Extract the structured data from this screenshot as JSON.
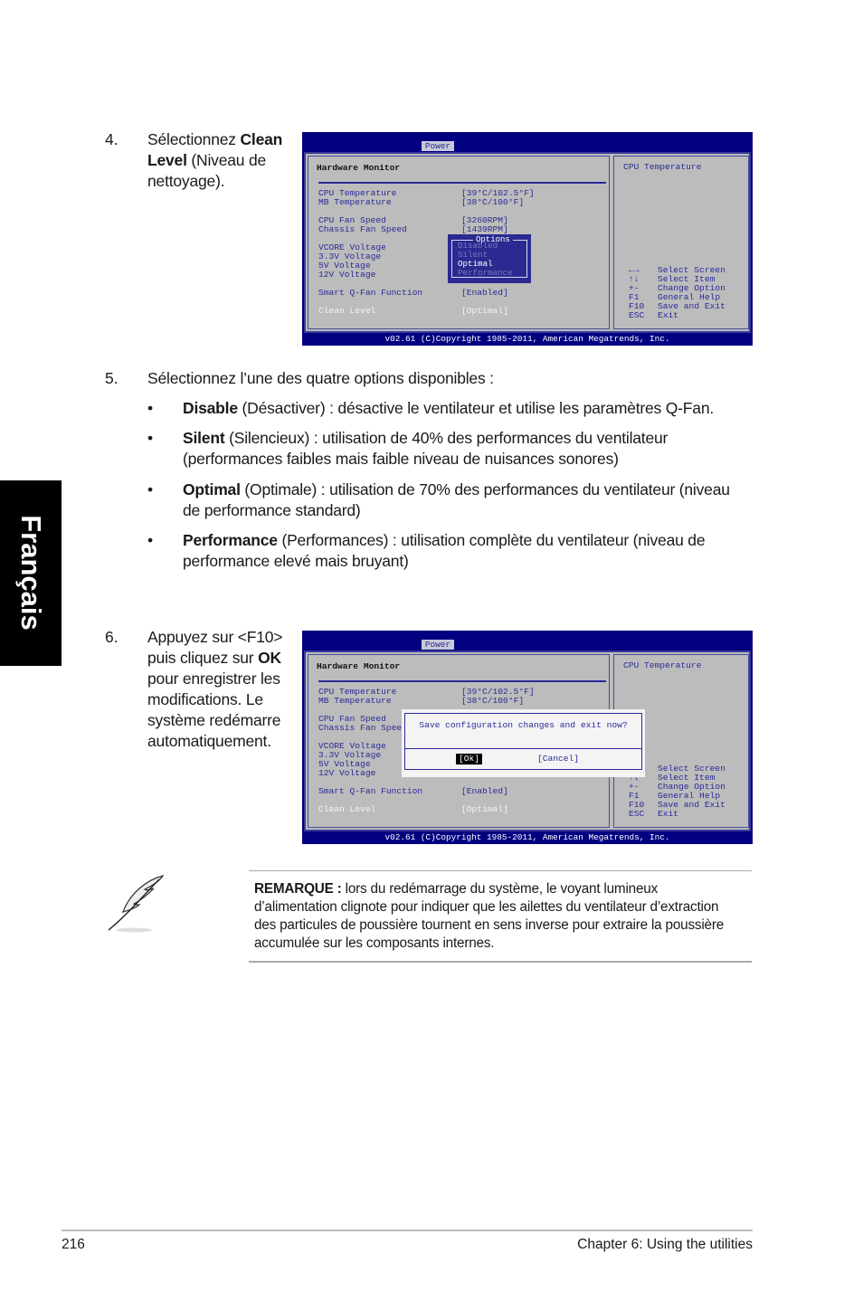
{
  "side_tab": "Français",
  "step4": {
    "number": "4.",
    "line1_pre": "Sélectionnez ",
    "line1_bold": "Clean",
    "line2_bold": "Level",
    "line2_rest": " (Niveau de",
    "line3": "nettoyage)."
  },
  "step5": {
    "number": "5.",
    "text": "Sélectionnez l’une des quatre options disponibles :",
    "bullets": [
      {
        "bold": "Disable",
        "lines": [
          " (Désactiver) : désactive le ventilateur et utilise les paramètres Q-Fan."
        ]
      },
      {
        "bold": "Silent",
        "lines": [
          " (Silencieux) : utilisation de 40% des performances du ventilateur",
          "(performances faibles mais faible niveau de nuisances sonores)"
        ]
      },
      {
        "bold": "Optimal",
        "lines": [
          " (Optimale) : utilisation de 70% des performances du ventilateur (niveau",
          "de performance standard)"
        ]
      },
      {
        "bold": "Performance",
        "lines": [
          " (Performances) : utilisation complète du ventilateur (niveau de",
          "performance elevé mais bruyant)"
        ]
      }
    ]
  },
  "step6": {
    "number": "6.",
    "line1": "Appuyez sur <F10>",
    "line2_pre": "puis cliquez sur ",
    "line2_bold": "OK",
    "line3": "pour enregistrer les",
    "line4": "modifications. Le",
    "line5": "système redémarre",
    "line6": "automatiquement."
  },
  "bios": {
    "tab": "Power",
    "section": "Hardware Monitor",
    "help_title": "CPU Temperature",
    "rows": [
      {
        "label": "CPU Temperature",
        "value": "[39°C/102.5°F]"
      },
      {
        "label": "MB Temperature",
        "value": "[38°C/100°F]"
      },
      {
        "label": "CPU Fan Speed",
        "value": "[3260RPM]"
      },
      {
        "label": "Chassis Fan Speed",
        "value": "[1439RPM]"
      },
      {
        "label": "VCORE Voltage",
        "value": ""
      },
      {
        "label": "3.3V Voltage",
        "value": ""
      },
      {
        "label": "5V Voltage",
        "value": ""
      },
      {
        "label": "12V Voltage",
        "value": ""
      },
      {
        "label": "Smart Q-Fan Function",
        "value": "[Enabled]"
      },
      {
        "label": "Clean Level",
        "value": "[Optimal]"
      }
    ],
    "keys": [
      {
        "key": "←→",
        "desc": "Select Screen"
      },
      {
        "key": "↑↓",
        "desc": "Select Item"
      },
      {
        "key": "+-",
        "desc": "Change Option"
      },
      {
        "key": "F1",
        "desc": "General Help"
      },
      {
        "key": "F10",
        "desc": "Save and Exit"
      },
      {
        "key": "ESC",
        "desc": "Exit"
      }
    ],
    "footer": "v02.61 (C)Copyright 1985-2011, American Megatrends, Inc.",
    "options": {
      "title": "Options",
      "items": [
        "Disabled",
        "Silent",
        "Optimal",
        "Performance"
      ],
      "selected": "Optimal"
    },
    "dialog": {
      "question": "Save configuration changes and exit now?",
      "ok": "[Ok]",
      "cancel": "[Cancel]"
    },
    "colors": {
      "frame": "#000080",
      "panel": "#bcbcbc",
      "text": "#2a2a98"
    }
  },
  "note": {
    "bold": "REMARQUE :",
    "lines": [
      " lors du redémarrage du système, le voyant lumineux",
      "d’alimentation clignote pour indiquer que les ailettes du ventilateur d’extraction",
      "des particules de poussière tournent en sens inverse pour extraire la poussière",
      "accumulée sur les composants internes."
    ],
    "icon": "feather-quill-icon"
  },
  "footer": {
    "page": "216",
    "chapter": "Chapter 6: Using the utilities"
  }
}
